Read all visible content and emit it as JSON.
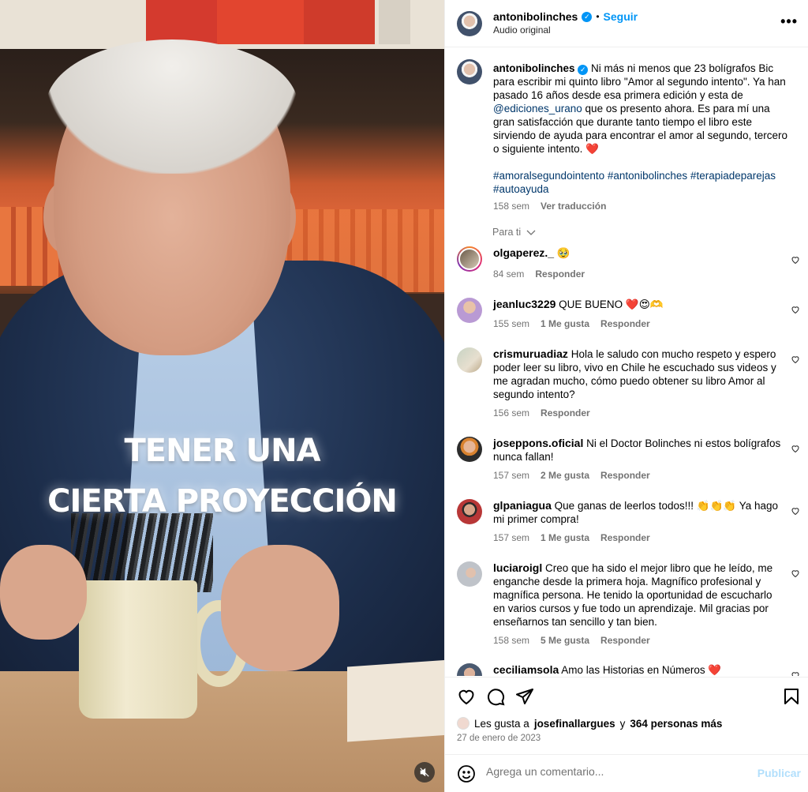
{
  "video": {
    "caption_line1": "TENER UNA",
    "caption_line2": "CIERTA PROYECCIÓN",
    "mute_icon": "speaker-muted-icon"
  },
  "header": {
    "username": "antonibolinches",
    "follow_label": "Seguir",
    "separator": "•",
    "audio_label": "Audio original",
    "more_label": "•••"
  },
  "post_caption": {
    "username": "antonibolinches",
    "text_part1": "Ni más ni menos que 23 bolígrafos Bic para escribir mi quinto libro \"Amor al segundo intento\". Ya han pasado 16 años desde esa primera edición y esta de",
    "mention": "@ediciones_urano",
    "text_part2": "que os presento ahora. Es para mí una gran satisfacción que durante tanto tiempo el libro este sirviendo de ayuda para encontrar el amor al segundo, tercero o siguiente intento. ❤️",
    "hashtags": "#amoralsegundointento #antonibolinches #terapiadeparejas #autoayuda",
    "time": "158 sem",
    "translate_label": "Ver traducción"
  },
  "filter": {
    "label": "Para ti"
  },
  "comments": [
    {
      "username": "olgaperez._",
      "text": "🥹",
      "time": "84 sem",
      "likes": "",
      "reply": "Responder"
    },
    {
      "username": "jeanluc3229",
      "text": "QUE BUENO ❤️😍🫶",
      "time": "155 sem",
      "likes": "1 Me gusta",
      "reply": "Responder"
    },
    {
      "username": "crismuruadiaz",
      "text": "Hola le saludo con mucho respeto y espero poder leer su libro, vivo en Chile he escuchado sus videos y me agradan mucho, cómo puedo obtener su libro Amor al segundo intento?",
      "time": "156 sem",
      "likes": "",
      "reply": "Responder"
    },
    {
      "username": "joseppons.oficial",
      "text": "Ni el Doctor Bolinches ni estos bolígrafos nunca fallan!",
      "time": "157 sem",
      "likes": "2 Me gusta",
      "reply": "Responder"
    },
    {
      "username": "glpaniagua",
      "text": "Que ganas de leerlos todos!!! 👏👏👏 Ya hago mi primer compra!",
      "time": "157 sem",
      "likes": "1 Me gusta",
      "reply": "Responder"
    },
    {
      "username": "luciaroigl",
      "text": "Creo que ha sido el mejor libro que he leído, me enganche desde la primera hoja. Magnífico profesional y magnífica persona. He tenido la oportunidad de escucharlo en varios cursos y fue todo un aprendizaje. Mil gracias por enseñarnos tan sencillo y tan bien.",
      "time": "158 sem",
      "likes": "5 Me gusta",
      "reply": "Responder"
    },
    {
      "username": "ceciliamsola",
      "text": "Amo las Historias en Números ❤️",
      "time": "",
      "likes": "",
      "reply": ""
    }
  ],
  "actions": {
    "likes_prefix": "Les gusta a",
    "likes_user": "josefinallargues",
    "likes_join": "y",
    "likes_count": "364 personas más",
    "date": "27 de enero de 2023"
  },
  "add_comment": {
    "placeholder": "Agrega un comentario...",
    "publish_label": "Publicar"
  },
  "colors": {
    "accent": "#0095f6",
    "link": "#00376b",
    "muted": "#737373",
    "publish_disabled": "#b2dffc"
  }
}
